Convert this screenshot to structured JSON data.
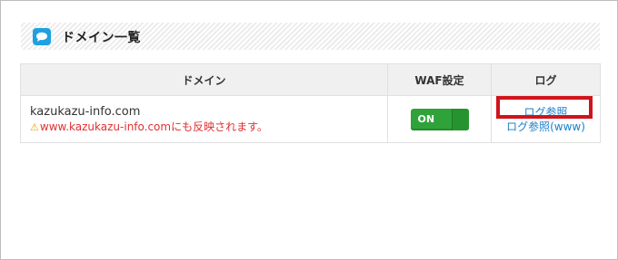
{
  "section": {
    "title": "ドメイン一覧",
    "icon": "speech-bubble-icon"
  },
  "table": {
    "headers": {
      "domain": "ドメイン",
      "waf": "WAF設定",
      "log": "ログ"
    },
    "rows": [
      {
        "domain": "kazukazu-info.com",
        "warning": "www.kazukazu-info.comにも反映されます。",
        "waf_toggle": "ON",
        "log_link": "ログ参照",
        "log_www_link": "ログ参照(www)"
      }
    ]
  },
  "colors": {
    "accent": "#1fa0e0",
    "toggle_on": "#2fa23a",
    "warning_text": "#e03030",
    "link": "#1a7fc8",
    "highlight": "#d0141c"
  }
}
